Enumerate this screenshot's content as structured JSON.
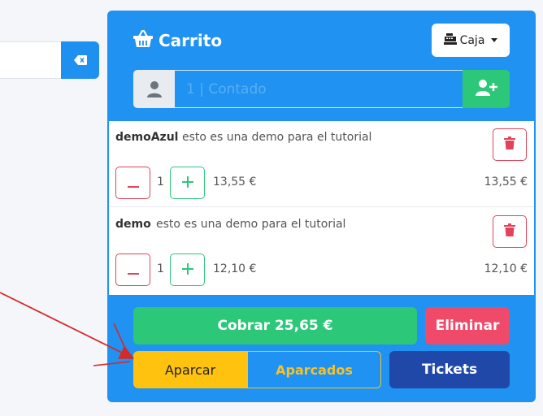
{
  "cart": {
    "title": "Carrito",
    "register_label": "Caja",
    "customer_placeholder": "1 | Contado"
  },
  "items": [
    {
      "name": "demoAzul",
      "description": "esto es una demo para el tutorial",
      "qty": "1",
      "unit_price": "13,55 €",
      "total": "13,55 €"
    },
    {
      "name": "demo",
      "description": "esto es una demo para el tutorial",
      "qty": "1",
      "unit_price": "12,10 €",
      "total": "12,10 €"
    }
  ],
  "actions": {
    "charge_label": "Cobrar 25,65 €",
    "delete_label": "Eliminar",
    "park_label": "Aparcar",
    "parked_label": "Aparcados",
    "tickets_label": "Tickets"
  },
  "colors": {
    "panel": "#1f92f2",
    "success": "#2dc77a",
    "danger": "#f04a6a",
    "warning": "#ffc30f",
    "dark_blue": "#2048a8"
  }
}
